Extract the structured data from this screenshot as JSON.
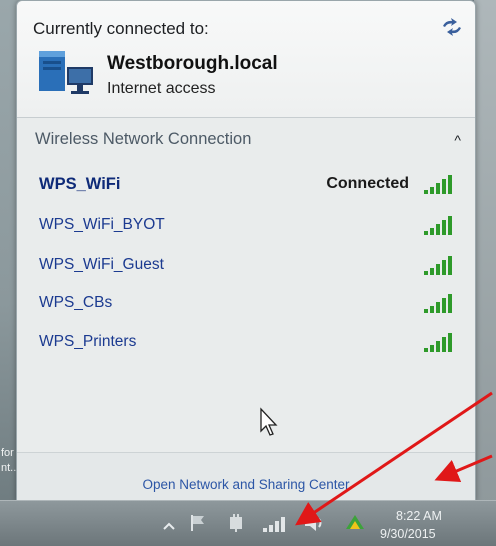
{
  "desktop": {
    "label_1": "for",
    "label_2": "nt..."
  },
  "popup": {
    "current_title": "Currently connected to:",
    "refresh_icon": "refresh-icon",
    "current_network": {
      "name": "Westborough.local",
      "status": "Internet access"
    },
    "group": {
      "title": "Wireless Network Connection",
      "collapse_glyph": "^"
    },
    "networks": [
      {
        "name": "WPS_WiFi",
        "status": "Connected",
        "bold": true
      },
      {
        "name": "WPS_WiFi_BYOT",
        "status": ""
      },
      {
        "name": "WPS_WiFi_Guest",
        "status": ""
      },
      {
        "name": "WPS_CBs",
        "status": ""
      },
      {
        "name": "WPS_Printers",
        "status": ""
      }
    ],
    "sharing_link": "Open Network and Sharing Center"
  },
  "taskbar": {
    "tray_icons": [
      "show-hidden-icons-arrow",
      "action-center-flag-icon",
      "power-plug-icon",
      "network-signal-icon",
      "volume-icon",
      "sync-icon"
    ],
    "clock_time": "8:22 AM",
    "clock_date": "9/30/2015"
  },
  "colors": {
    "link": "#2c56a6",
    "network_name": "#1b3a90",
    "signal_green": "#2e9a2a",
    "annotation_arrow": "#e01818"
  }
}
